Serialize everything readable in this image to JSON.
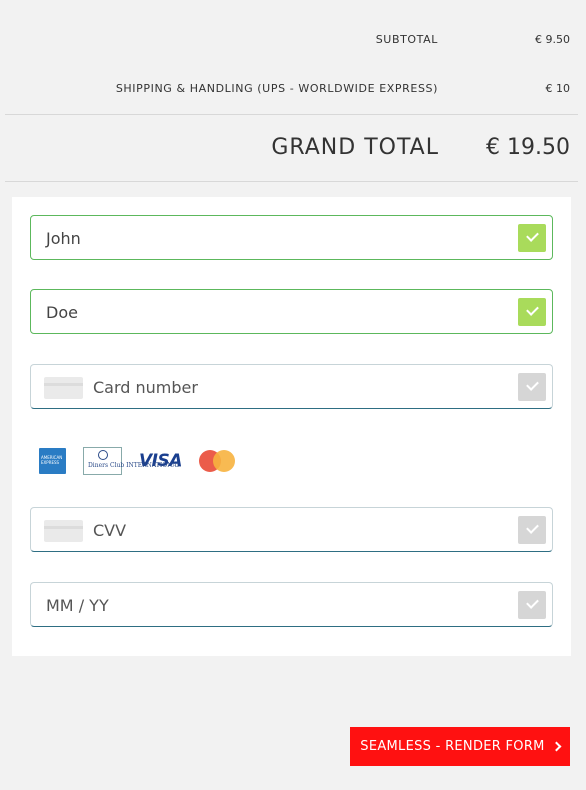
{
  "summary": {
    "subtotal_label": "SUBTOTAL",
    "subtotal_value": "€ 9.50",
    "shipping_label": "SHIPPING & HANDLING (UPS - WORLDWIDE EXPRESS)",
    "shipping_value": "€ 10",
    "grand_total_label": "GRAND TOTAL",
    "grand_total_value": "€ 19.50"
  },
  "form": {
    "first_name_value": "John",
    "last_name_value": "Doe",
    "card_number_placeholder": "Card number",
    "cvv_placeholder": "CVV",
    "expiry_placeholder": "MM / YY",
    "card_brands": [
      {
        "name": "amex-icon",
        "label": "AMERICAN EXPRESS"
      },
      {
        "name": "diners-club-icon",
        "label": "Diners Club INTERNATIONAL"
      },
      {
        "name": "visa-icon",
        "label": "VISA"
      },
      {
        "name": "mastercard-icon",
        "label": ""
      }
    ]
  },
  "actions": {
    "submit_label": "SEAMLESS - RENDER FORM"
  },
  "colors": {
    "valid_border": "#5cb85c",
    "valid_check": "#a9db5b",
    "neutral_check": "#d6d6d6",
    "button_bg": "#ff1111"
  }
}
